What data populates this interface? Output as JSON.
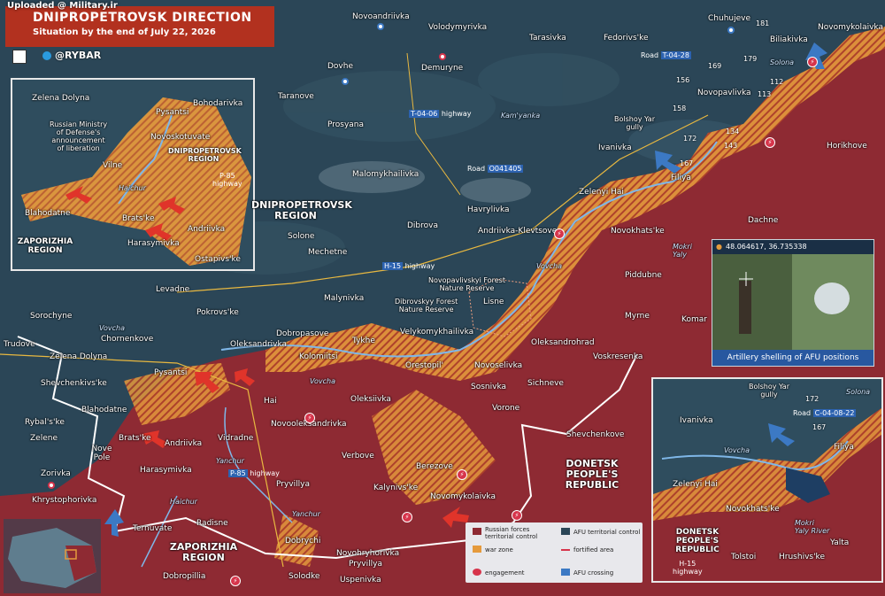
{
  "header": {
    "uploaded": "Uploaded @ Military.ir",
    "title": "DNIPROPETROVSK DIRECTION",
    "subtitle": "Situation by the end of July 22, 2026",
    "brand": "@RYBAR"
  },
  "colors": {
    "russian": "#8e2a33",
    "afu": "#2b4657",
    "war_zone": "#e59a3c",
    "header": "#b2311f",
    "road_badge": "#2c62b0"
  },
  "places": [
    {
      "n": "Novoandriivka"
    },
    {
      "n": "Volodymyrivka"
    },
    {
      "n": "Tarasivka"
    },
    {
      "n": "Fedorivs'ke"
    },
    {
      "n": "Chuhujeve"
    },
    {
      "n": "Biliakivka"
    },
    {
      "n": "Novomykolaivka"
    },
    {
      "n": "Dovhe"
    },
    {
      "n": "Demuryne"
    },
    {
      "n": "Taranove"
    },
    {
      "n": "Kam'yanka"
    },
    {
      "n": "Prosyana"
    },
    {
      "n": "Novopavlivka"
    },
    {
      "n": "Horikhove"
    },
    {
      "n": "Ivanivka"
    },
    {
      "n": "Filiya"
    },
    {
      "n": "Malomykhailivka"
    },
    {
      "n": "Zelenyi Hai"
    },
    {
      "n": "Havrylivka"
    },
    {
      "n": "Dachne"
    },
    {
      "n": "Andriivka-Klevtsove"
    },
    {
      "n": "Dibrova"
    },
    {
      "n": "Novokhats'ke"
    },
    {
      "n": "Solone"
    },
    {
      "n": "Mechetne"
    },
    {
      "n": "Piddubne"
    },
    {
      "n": "Levadne"
    },
    {
      "n": "Malynivka"
    },
    {
      "n": "Lisne"
    },
    {
      "n": "Myrne"
    },
    {
      "n": "Sorochyne"
    },
    {
      "n": "Pokrovs'ke"
    },
    {
      "n": "Komar"
    },
    {
      "n": "Trudove"
    },
    {
      "n": "Chornenkove"
    },
    {
      "n": "Oleksandrivka"
    },
    {
      "n": "Velykomykhailivka"
    },
    {
      "n": "Oleksandrohrad"
    },
    {
      "n": "Voskresenka"
    },
    {
      "n": "Zelena Dolyna"
    },
    {
      "n": "Dobropasove"
    },
    {
      "n": "Tykhe"
    },
    {
      "n": "Orestopil'"
    },
    {
      "n": "Pysantsi"
    },
    {
      "n": "Kolomiitsi"
    },
    {
      "n": "Novoselivka"
    },
    {
      "n": "Shevchenkivs'ke"
    },
    {
      "n": "Sosnivka"
    },
    {
      "n": "Sichneve"
    },
    {
      "n": "Hai"
    },
    {
      "n": "Oleksiivka"
    },
    {
      "n": "Vorone"
    },
    {
      "n": "Blahodatne"
    },
    {
      "n": "Novooleksandrivka"
    },
    {
      "n": "Rybal's'ke"
    },
    {
      "n": "Brats'ke"
    },
    {
      "n": "Andriivka"
    },
    {
      "n": "Vidradne"
    },
    {
      "n": "Shevchenkove"
    },
    {
      "n": "Zelene"
    },
    {
      "n": "Nove Pole"
    },
    {
      "n": "Verbove"
    },
    {
      "n": "Berezove"
    },
    {
      "n": "Harasymivka"
    },
    {
      "n": "Zorivka"
    },
    {
      "n": "Pryvillya"
    },
    {
      "n": "Kalynivs'ke"
    },
    {
      "n": "Novomykolaivka"
    },
    {
      "n": "Khrystophorivka"
    },
    {
      "n": "Ternuvate"
    },
    {
      "n": "Radisne"
    },
    {
      "n": "Dobrychi"
    },
    {
      "n": "Novohryhorivka"
    },
    {
      "n": "Pryvillya"
    },
    {
      "n": "Dobropillia"
    },
    {
      "n": "Solodke"
    },
    {
      "n": "Uspenivka"
    }
  ],
  "regions": [
    {
      "n": "DNIPROPETROVSK\nREGION"
    },
    {
      "n": "ZAPORIZHIA\nREGION"
    },
    {
      "n": "DONETSK\nPEOPLE'S\nREPUBLIC"
    }
  ],
  "roads": [
    {
      "prefix": "",
      "code": "T-04-06",
      "suffix": " highway"
    },
    {
      "prefix": "Road ",
      "code": "O041405",
      "suffix": ""
    },
    {
      "prefix": "Road ",
      "code": "T-04-28",
      "suffix": ""
    },
    {
      "prefix": "",
      "code": "H-15",
      "suffix": " highway"
    },
    {
      "prefix": "",
      "code": "P-85",
      "suffix": " highway"
    }
  ],
  "rivers": [
    "Vovcha",
    "Vovcha",
    "Vovcha",
    "Yanchur",
    "Yanchur",
    "Haichur",
    "Mokri Yaly",
    "Solona"
  ],
  "features": [
    {
      "n": "Bolshoy Yar\ngully"
    },
    {
      "n": "Novopavlivskyi Forest\nNature Reserve"
    },
    {
      "n": "Dibrovskyy Forest\nNature Reserve"
    }
  ],
  "heights": [
    "181",
    "179",
    "169",
    "156",
    "112",
    "113",
    "158",
    "134",
    "143",
    "172",
    "167"
  ],
  "inset_left": {
    "labels": [
      "Zelena Dolyna",
      "Pysantsi",
      "Bohodarivka",
      "Novoskotuvate",
      "Vilne",
      "Blahodatne",
      "Brats'ke",
      "Andriivka",
      "Harasymivka",
      "Ostapivs'ke"
    ],
    "region": "DNIPROPETROVSK\nREGION",
    "region2": "ZAPORIZHIA\nREGION",
    "note": "Russian Ministry\nof Defense's\nannouncement\nof liberation",
    "road": "P-85\nhighway",
    "river": "Haichur"
  },
  "inset_right": {
    "labels": [
      "Ivanivka",
      "Filiya",
      "Zelenyi Hai",
      "Novokhats'ke",
      "Tolstoi",
      "Hrushivs'ke",
      "Yalta"
    ],
    "region": "DONETSK\nPEOPLE'S\nREPUBLIC",
    "road_prefix": "Road ",
    "road_code": "C-04-08-22",
    "road2": "H-15\nhighway",
    "feature": "Bolshoy Yar\ngully",
    "river": "Vovcha",
    "river2": "Solona",
    "river3": "Mokri\nYaly River",
    "h1": "172",
    "h2": "167"
  },
  "photo": {
    "coords": "48.064617, 36.735338",
    "caption": "Artillery shelling of AFU positions"
  },
  "legend": {
    "russian": "Russian forces\nterritorial control",
    "afu": "AFU territorial control",
    "war_zone": "war zone",
    "fortified": "fortified area",
    "engagement": "engagement",
    "crossing": "AFU crossing"
  }
}
